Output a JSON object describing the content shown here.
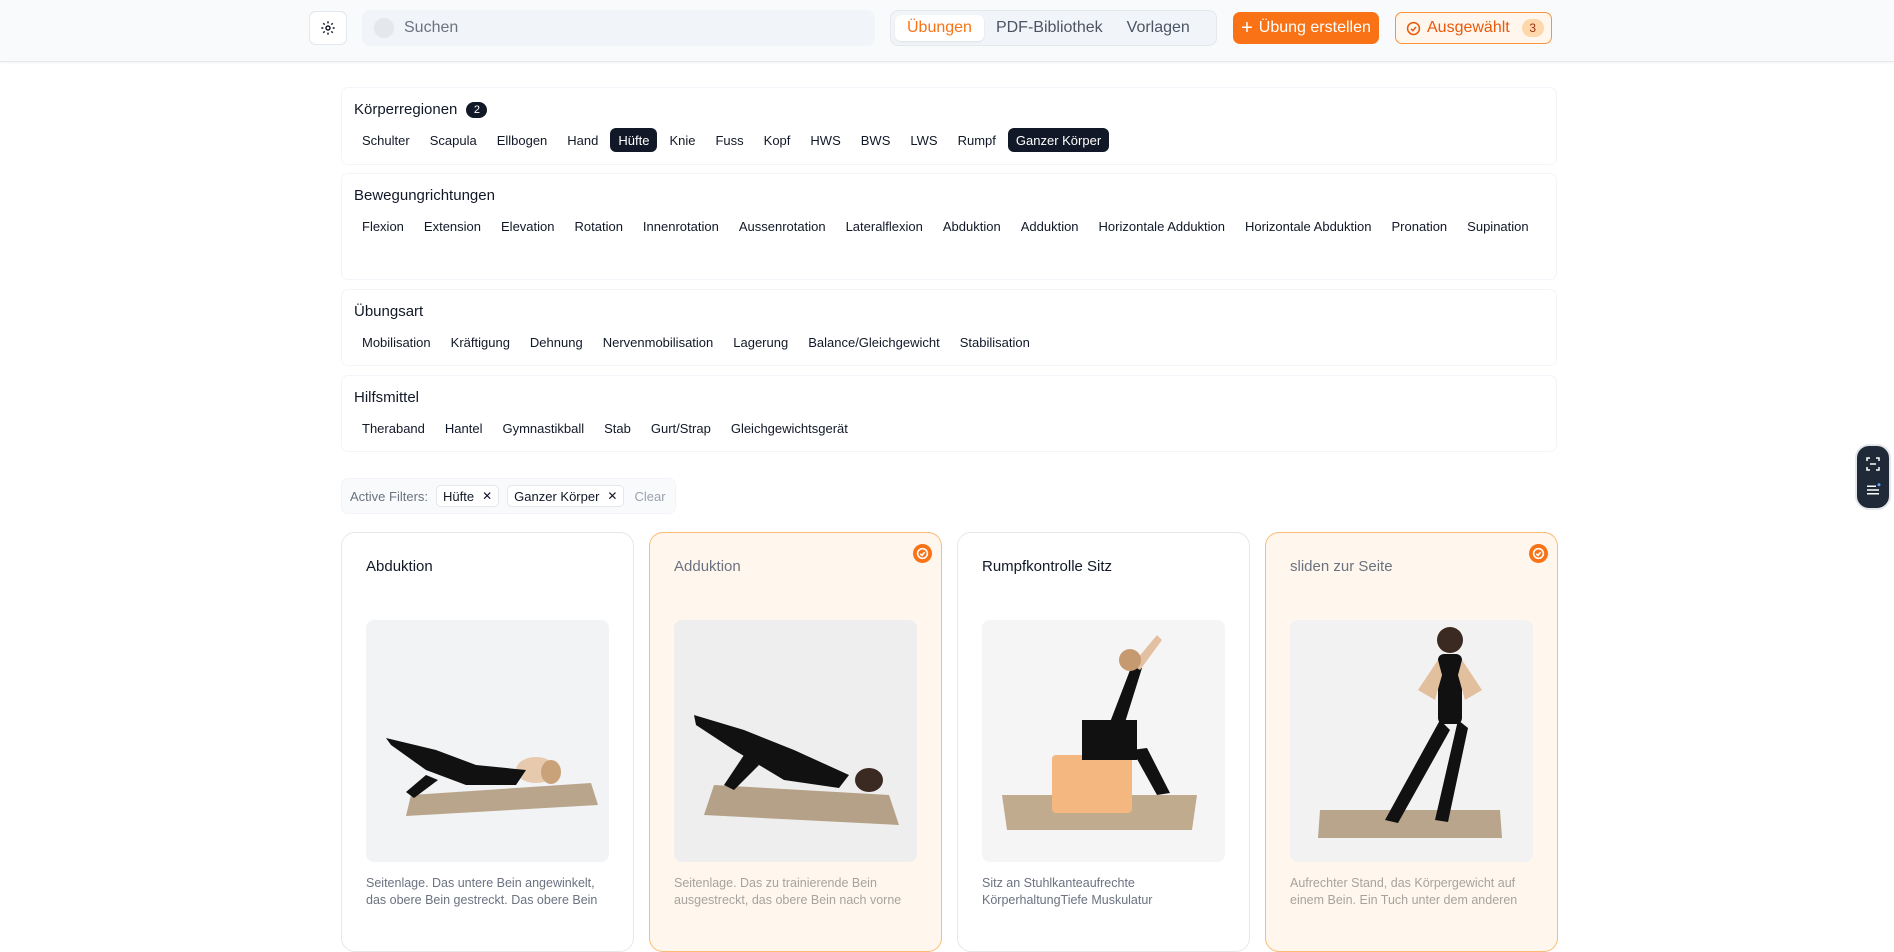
{
  "topbar": {
    "search_placeholder": "Suchen",
    "tabs": [
      {
        "label": "Übungen",
        "active": true
      },
      {
        "label": "PDF-Bibliothek",
        "active": false
      },
      {
        "label": "Vorlagen",
        "active": false
      }
    ],
    "create_label": "Übung erstellen",
    "selected_label": "Ausgewählt",
    "selected_count": "3"
  },
  "filters": {
    "body_regions": {
      "title": "Körperregionen",
      "badge": "2",
      "items": [
        "Schulter",
        "Scapula",
        "Ellbogen",
        "Hand",
        "Hüfte",
        "Knie",
        "Fuss",
        "Kopf",
        "HWS",
        "BWS",
        "LWS",
        "Rumpf",
        "Ganzer Körper"
      ],
      "selected": [
        "Hüfte",
        "Ganzer Körper"
      ]
    },
    "movement": {
      "title": "Bewegungrichtungen",
      "items": [
        "Flexion",
        "Extension",
        "Elevation",
        "Rotation",
        "Innenrotation",
        "Aussenrotation",
        "Lateralflexion",
        "Abduktion",
        "Adduktion",
        "Horizontale Adduktion",
        "Horizontale Abduktion",
        "Pronation",
        "Supination"
      ]
    },
    "type": {
      "title": "Übungsart",
      "items": [
        "Mobilisation",
        "Kräftigung",
        "Dehnung",
        "Nervenmobilisation",
        "Lagerung",
        "Balance/Gleichgewicht",
        "Stabilisation"
      ]
    },
    "aids": {
      "title": "Hilfsmittel",
      "items": [
        "Theraband",
        "Hantel",
        "Gymnastikball",
        "Stab",
        "Gurt/Strap",
        "Gleichgewichtsgerät"
      ]
    }
  },
  "active_filters": {
    "label": "Active Filters:",
    "items": [
      "Hüfte",
      "Ganzer Körper"
    ],
    "clear_label": "Clear"
  },
  "cards": [
    {
      "title": "Abduktion",
      "selected": false,
      "desc": "Seitenlage. Das untere Bein angewinkelt, das obere Bein gestreckt. Das obere Bein"
    },
    {
      "title": "Adduktion",
      "selected": true,
      "desc": "Seitenlage. Das zu trainierende Bein ausgestreckt, das obere Bein nach vorne"
    },
    {
      "title": "Rumpfkontrolle Sitz",
      "selected": false,
      "desc": "Sitz an Stuhlkanteaufrechte KörperhaltungTiefe Muskulatur"
    },
    {
      "title": "sliden zur Seite",
      "selected": true,
      "desc": "Aufrechter Stand, das Körpergewicht auf einem Bein. Ein Tuch unter dem anderen"
    }
  ],
  "colors": {
    "accent": "#f97316",
    "dark_chip": "#111827"
  },
  "icons": [
    "settings-icon",
    "plus-icon",
    "check-circle-icon",
    "close-icon",
    "scan-icon",
    "list-icon"
  ]
}
